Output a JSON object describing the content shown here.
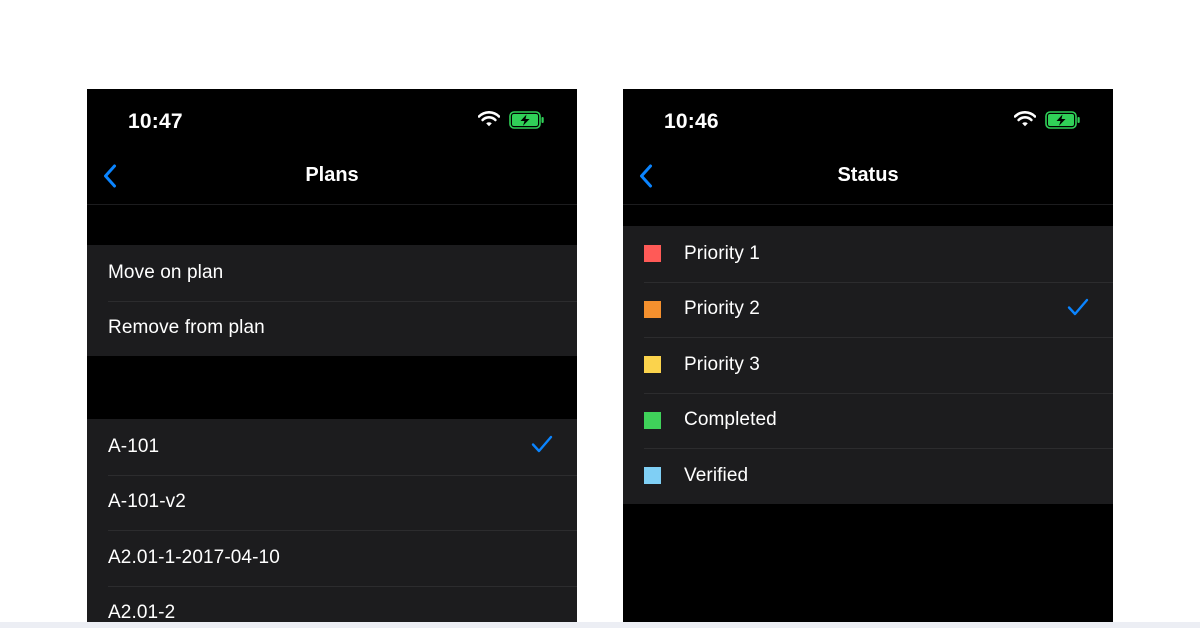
{
  "left_screen": {
    "status_bar": {
      "time": "10:47"
    },
    "nav": {
      "title": "Plans"
    },
    "actions": [
      {
        "label": "Move on plan"
      },
      {
        "label": "Remove from plan"
      }
    ],
    "plans": [
      {
        "label": "A-101",
        "selected": true
      },
      {
        "label": "A-101-v2",
        "selected": false
      },
      {
        "label": "A2.01-1-2017-04-10",
        "selected": false
      },
      {
        "label": "A2.01-2",
        "selected": false
      }
    ]
  },
  "right_screen": {
    "status_bar": {
      "time": "10:46"
    },
    "nav": {
      "title": "Status"
    },
    "statuses": [
      {
        "label": "Priority 1",
        "color": "#ff5a57",
        "selected": false
      },
      {
        "label": "Priority 2",
        "color": "#f4902e",
        "selected": true
      },
      {
        "label": "Priority 3",
        "color": "#fbd34c",
        "selected": false
      },
      {
        "label": "Completed",
        "color": "#3fd25a",
        "selected": false
      },
      {
        "label": "Verified",
        "color": "#7fcff5",
        "selected": false
      }
    ]
  },
  "colors": {
    "accent": "#0a84ff",
    "battery_fill": "#30d158",
    "cell_background": "#1c1c1e",
    "screen_background": "#000000"
  },
  "icons": {
    "back": "chevron-left-icon",
    "wifi": "wifi-icon",
    "battery": "battery-charging-icon",
    "selected": "checkmark-icon"
  }
}
